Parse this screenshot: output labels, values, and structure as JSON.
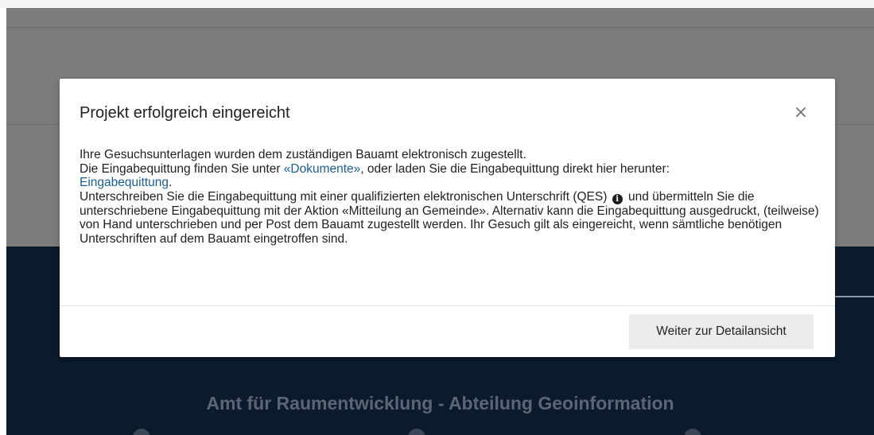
{
  "background": {
    "footer_title": "Amt für Raumentwicklung - Abteilung Geoinformation"
  },
  "modal": {
    "title": "Projekt erfolgreich eingereicht",
    "close_label": "×",
    "line1": "Ihre Gesuchsunterlagen wurden dem zuständigen Bauamt elektronisch zugestellt.",
    "line2_before": "Die Eingabequittung finden Sie unter ",
    "documents_link": "«Dokumente»",
    "line2_after": ", oder laden Sie die Eingabequittung direkt hier herunter:",
    "receipt_link": "Eingabequittung",
    "receipt_after": ".",
    "para2_before": "Unterschreiben Sie die Eingabequittung mit einer qualifizierten elektronischen Unterschrift (QES)",
    "info_icon_glyph": "i",
    "para2_after": "und übermitteln Sie die unterschriebene Eingabequittung mit der Aktion «Mitteilung an Gemeinde». Alternativ kann die Eingabequittung ausgedruckt, (teilweise) von Hand unterschrieben und per Post dem Bauamt zugestellt werden. Ihr Gesuch gilt als eingereicht, wenn sämtliche benötigen Unterschriften auf dem Bauamt eingetroffen sind.",
    "detail_button": "Weiter zur Detailansicht"
  },
  "colors": {
    "overlay_gray": "#7c7c7c",
    "navy": "#0b1a2c",
    "link": "#1a5e95",
    "button_bg": "#ececec"
  },
  "icons": {
    "close": "close-icon",
    "info": "info-circle-icon"
  }
}
